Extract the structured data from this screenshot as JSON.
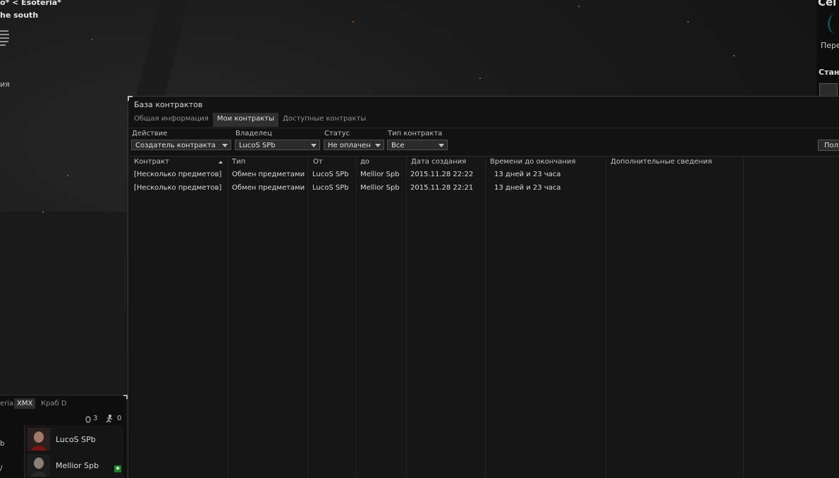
{
  "overlay": {
    "location_line1": "o* < Esoteria*",
    "location_line2": "he south",
    "location_line3": "ия"
  },
  "side_panel": {
    "title": "Cel",
    "link": "Пере",
    "station_label": "Станц"
  },
  "window": {
    "title": "База контрактов",
    "tabs": [
      {
        "label": "Общая информация",
        "active": false
      },
      {
        "label": "Мои контракты",
        "active": true
      },
      {
        "label": "Доступные контракты",
        "active": false
      }
    ],
    "filters": {
      "action": {
        "label": "Действие",
        "value": "Создатель контракта"
      },
      "owner": {
        "label": "Владелец",
        "value": "LucoS SPb"
      },
      "status": {
        "label": "Статус",
        "value": "Не оплачен"
      },
      "contract_type": {
        "label": "Тип контракта",
        "value": "Все"
      }
    },
    "get_button": "Пол",
    "table": {
      "columns": [
        "Контракт",
        "Тип",
        "От",
        "до",
        "Дата создания",
        "Времени до окончания",
        "Дополнительные сведения"
      ],
      "rows": [
        [
          "[Несколько предметов]",
          "Обмен предметами",
          "LucoS SPb",
          "Mellior Spb",
          "2015.11.28 22:22",
          "13 дней и 23 часа",
          ""
        ],
        [
          "[Несколько предметов]",
          "Обмен предметами",
          "LucoS SPb",
          "Mellior Spb",
          "2015.11.28 22:21",
          "13 дней и 23 часа",
          ""
        ]
      ]
    }
  },
  "chat": {
    "tabs": [
      {
        "label": "eria",
        "active": false
      },
      {
        "label": "XMX",
        "active": true
      },
      {
        "label": "Краб D",
        "active": false
      }
    ],
    "stat_a": "3",
    "stat_b": "0",
    "side_lines": [
      "b",
      "/"
    ],
    "members": [
      {
        "name": "LucoS SPb"
      },
      {
        "name": "Mellior Spb"
      }
    ],
    "fleet_badge": "★",
    "colors": {
      "accent_green": "#1b7a2b"
    }
  }
}
